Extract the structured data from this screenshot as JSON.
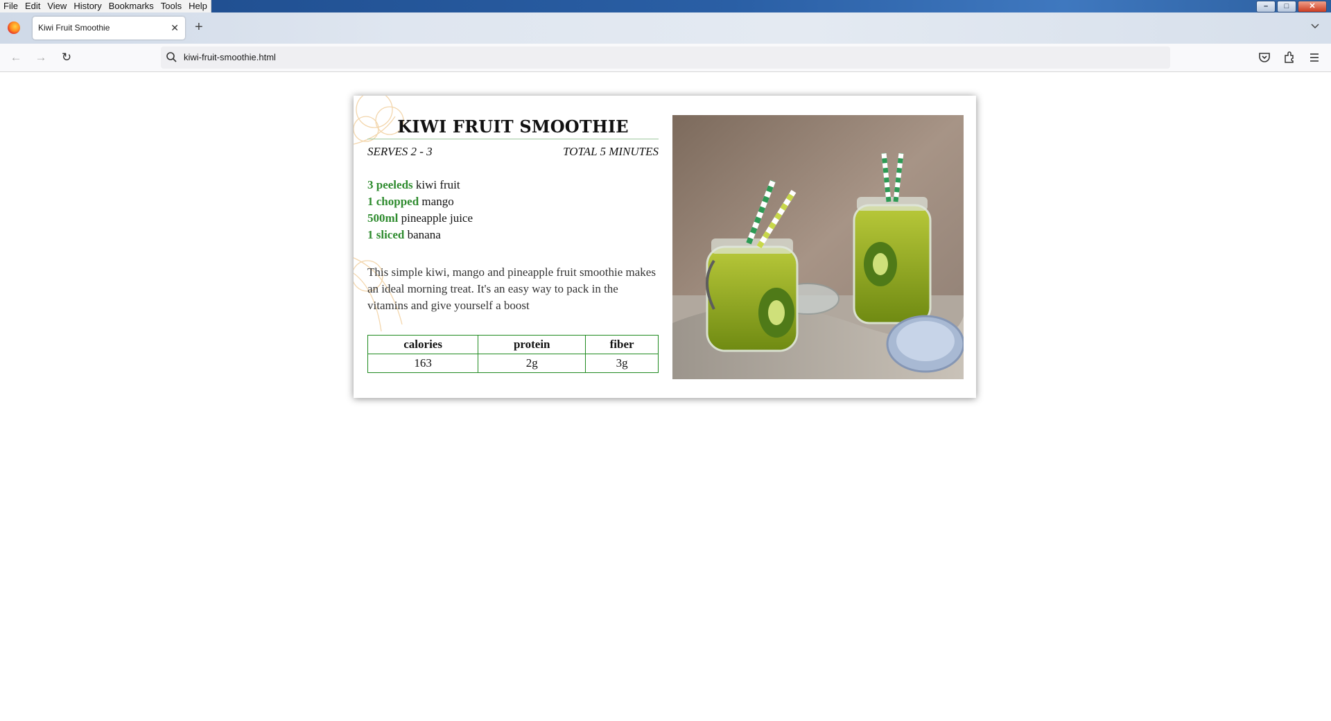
{
  "menu": [
    "File",
    "Edit",
    "View",
    "History",
    "Bookmarks",
    "Tools",
    "Help"
  ],
  "window_controls": {
    "minimize": "–",
    "maximize": "□",
    "close": "✕"
  },
  "tab": {
    "title": "Kiwi Fruit Smoothie",
    "close": "✕",
    "new_tab": "+"
  },
  "nav": {
    "back": "←",
    "forward": "→",
    "reload": "↻"
  },
  "urlbar": {
    "value": "kiwi-fruit-smoothie.html"
  },
  "toolbar_icons": [
    "pocket-icon",
    "extensions-icon",
    "menu-icon"
  ],
  "recipe": {
    "title": "KIWI FRUIT SMOOTHIE",
    "serves": "SERVES 2 - 3",
    "total_time": "TOTAL 5 MINUTES",
    "ingredients": [
      {
        "qty": "3 peeleds",
        "item": "kiwi fruit"
      },
      {
        "qty": "1 chopped",
        "item": "mango"
      },
      {
        "qty": "500ml",
        "item": "pineapple juice"
      },
      {
        "qty": "1 sliced",
        "item": "banana"
      }
    ],
    "description": "This simple kiwi, mango and pineapple fruit smoothie makes an ideal morning treat. It's an easy way to pack in the vitamins and give yourself a boost",
    "nutrition": {
      "headers": [
        "calories",
        "protein",
        "fiber"
      ],
      "values": [
        "163",
        "2g",
        "3g"
      ]
    },
    "accent_color": "#2e8b2e",
    "table_border_color": "#1f8a1f"
  }
}
